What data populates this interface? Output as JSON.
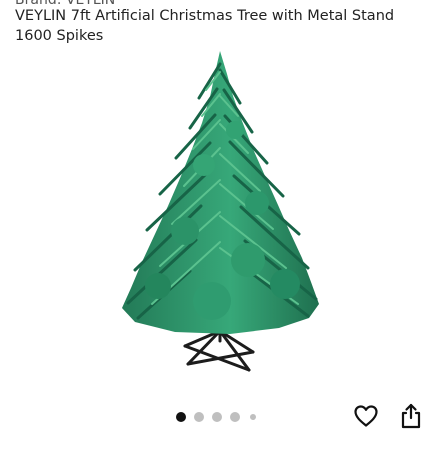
{
  "product": {
    "brand_line": "Brand: VEYLIN",
    "title": "VEYLIN 7ft Artificial Christmas Tree with Metal Stand 1600 Spikes"
  },
  "gallery": {
    "image_alt": "VEYLIN 7ft Artificial Christmas Tree with Metal Stand 1600 Spikes",
    "image_count": 5,
    "active_index": 0
  },
  "actions": {
    "wishlist_icon": "heart-outline-icon",
    "share_icon": "share-icon"
  },
  "colors": {
    "tree_green": "#2f8f6b",
    "active_dot": "#111111",
    "inactive_dot": "#bfbfbf"
  }
}
